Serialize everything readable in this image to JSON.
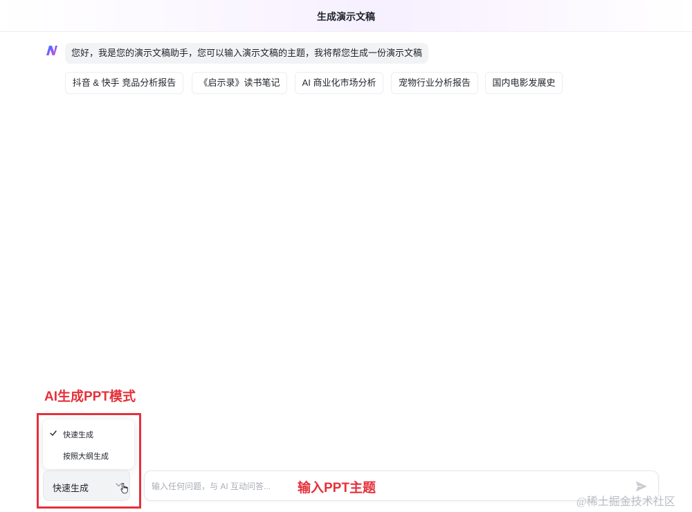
{
  "header": {
    "title": "生成演示文稿"
  },
  "assistant": {
    "logo_icon": "brand-logo-icon",
    "greeting": "您好，我是您的演示文稿助手，您可以输入演示文稿的主题，我将帮您生成一份演示文稿"
  },
  "suggestions": [
    "抖音 & 快手 竞品分析报告",
    "《启示录》读书笔记",
    "AI 商业化市场分析",
    "宠物行业分析报告",
    "国内电影发展史"
  ],
  "annotations": {
    "mode_title": "AI生成PPT模式",
    "input_label": "输入PPT主题",
    "color": "#e5303a"
  },
  "mode_menu": {
    "options": [
      {
        "label": "快速生成",
        "selected": true
      },
      {
        "label": "按照大纲生成",
        "selected": false
      }
    ],
    "current": "快速生成"
  },
  "composer": {
    "placeholder": "输入任何问题，与 AI 互动问答...",
    "send_icon": "send-icon"
  },
  "watermark": "@稀土掘金技术社区",
  "colors": {
    "accent": "#e5303a",
    "chip_border": "#ebedf0",
    "bubble_bg": "#f2f3f5"
  }
}
